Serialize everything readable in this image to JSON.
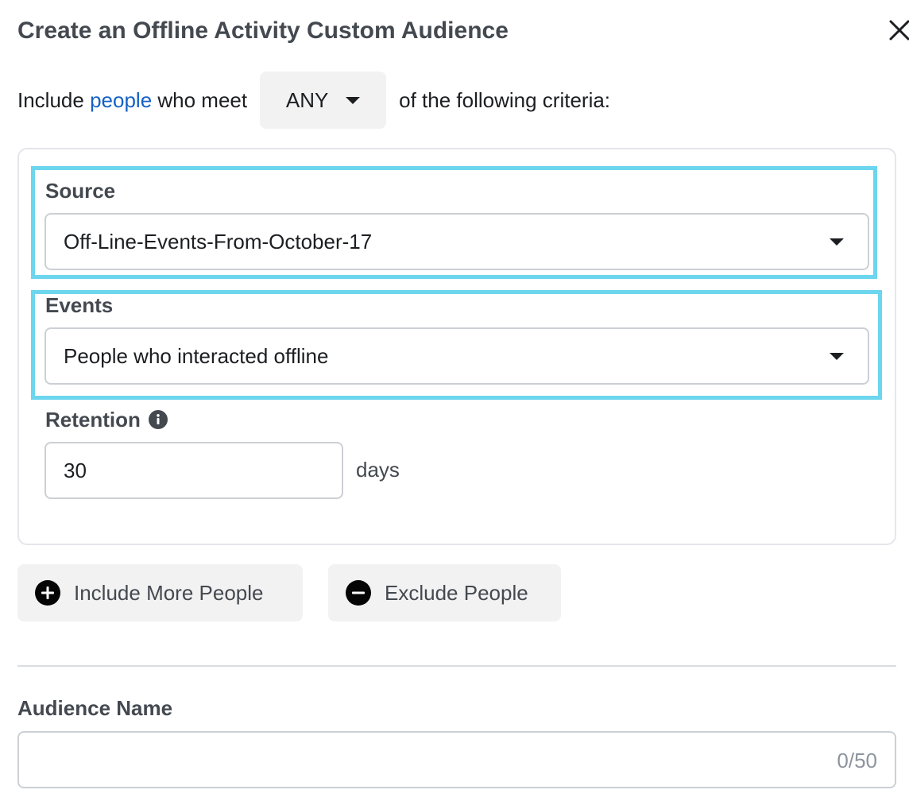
{
  "dialog": {
    "title": "Create an Offline Activity Custom Audience"
  },
  "criteria": {
    "prefix": "Include",
    "link_text": "people",
    "middle": "who meet",
    "match_value": "ANY",
    "suffix": "of the following criteria:"
  },
  "rule": {
    "source_label": "Source",
    "source_value": "Off-Line-Events-From-October-17",
    "events_label": "Events",
    "events_value": "People who interacted offline",
    "retention_label": "Retention",
    "retention_value": "30",
    "retention_unit": "days"
  },
  "actions": {
    "include_label": "Include More People",
    "exclude_label": "Exclude People"
  },
  "audience_name": {
    "label": "Audience Name",
    "value": "",
    "char_count": "0/50"
  },
  "colors": {
    "highlight": "#6bd6ed",
    "link": "#1461c5"
  },
  "icons": {
    "close": "close-icon",
    "dropdown": "caret-down-icon",
    "info": "info-icon",
    "include": "plus-circle-icon",
    "exclude": "minus-circle-icon"
  }
}
